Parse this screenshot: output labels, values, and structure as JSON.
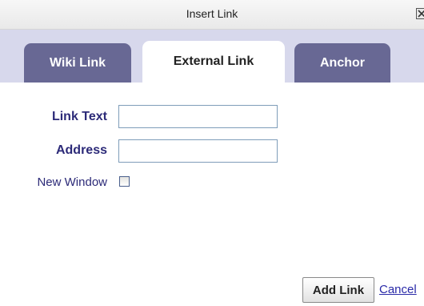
{
  "dialog": {
    "title": "Insert Link",
    "close_icon": "close-icon"
  },
  "tabs": [
    {
      "label": "Wiki Link",
      "active": false
    },
    {
      "label": "External Link",
      "active": true
    },
    {
      "label": "Anchor",
      "active": false
    }
  ],
  "form": {
    "link_text_label": "Link Text",
    "link_text_value": "",
    "address_label": "Address",
    "address_value": "",
    "new_window_label": "New Window",
    "new_window_checked": false
  },
  "actions": {
    "add_label": "Add Link",
    "cancel_label": "Cancel"
  },
  "colors": {
    "tab_band": "#d7d8ec",
    "tab_inactive": "#686894",
    "label_text": "#2c2a78",
    "link": "#2a2aa8"
  }
}
